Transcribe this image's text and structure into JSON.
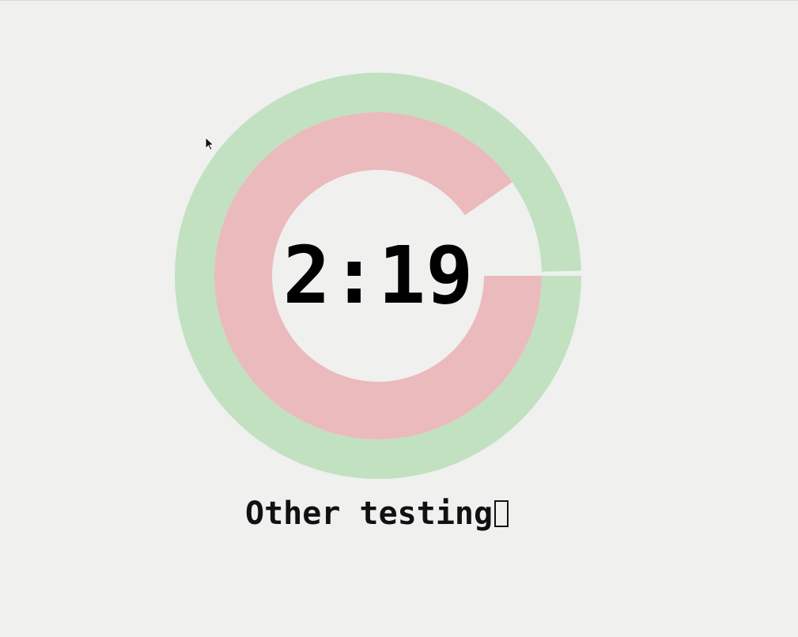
{
  "timer": {
    "time_display": "2:19",
    "label": "Other testing",
    "outer_ring": {
      "progress": 0.996,
      "color": "#c1e1c1"
    },
    "inner_ring": {
      "progress": 0.903,
      "color": "#ebbabd"
    },
    "label_trailing_glyph": "missing-glyph-icon"
  },
  "colors": {
    "background": "#f0f0ef",
    "text": "#000000"
  }
}
